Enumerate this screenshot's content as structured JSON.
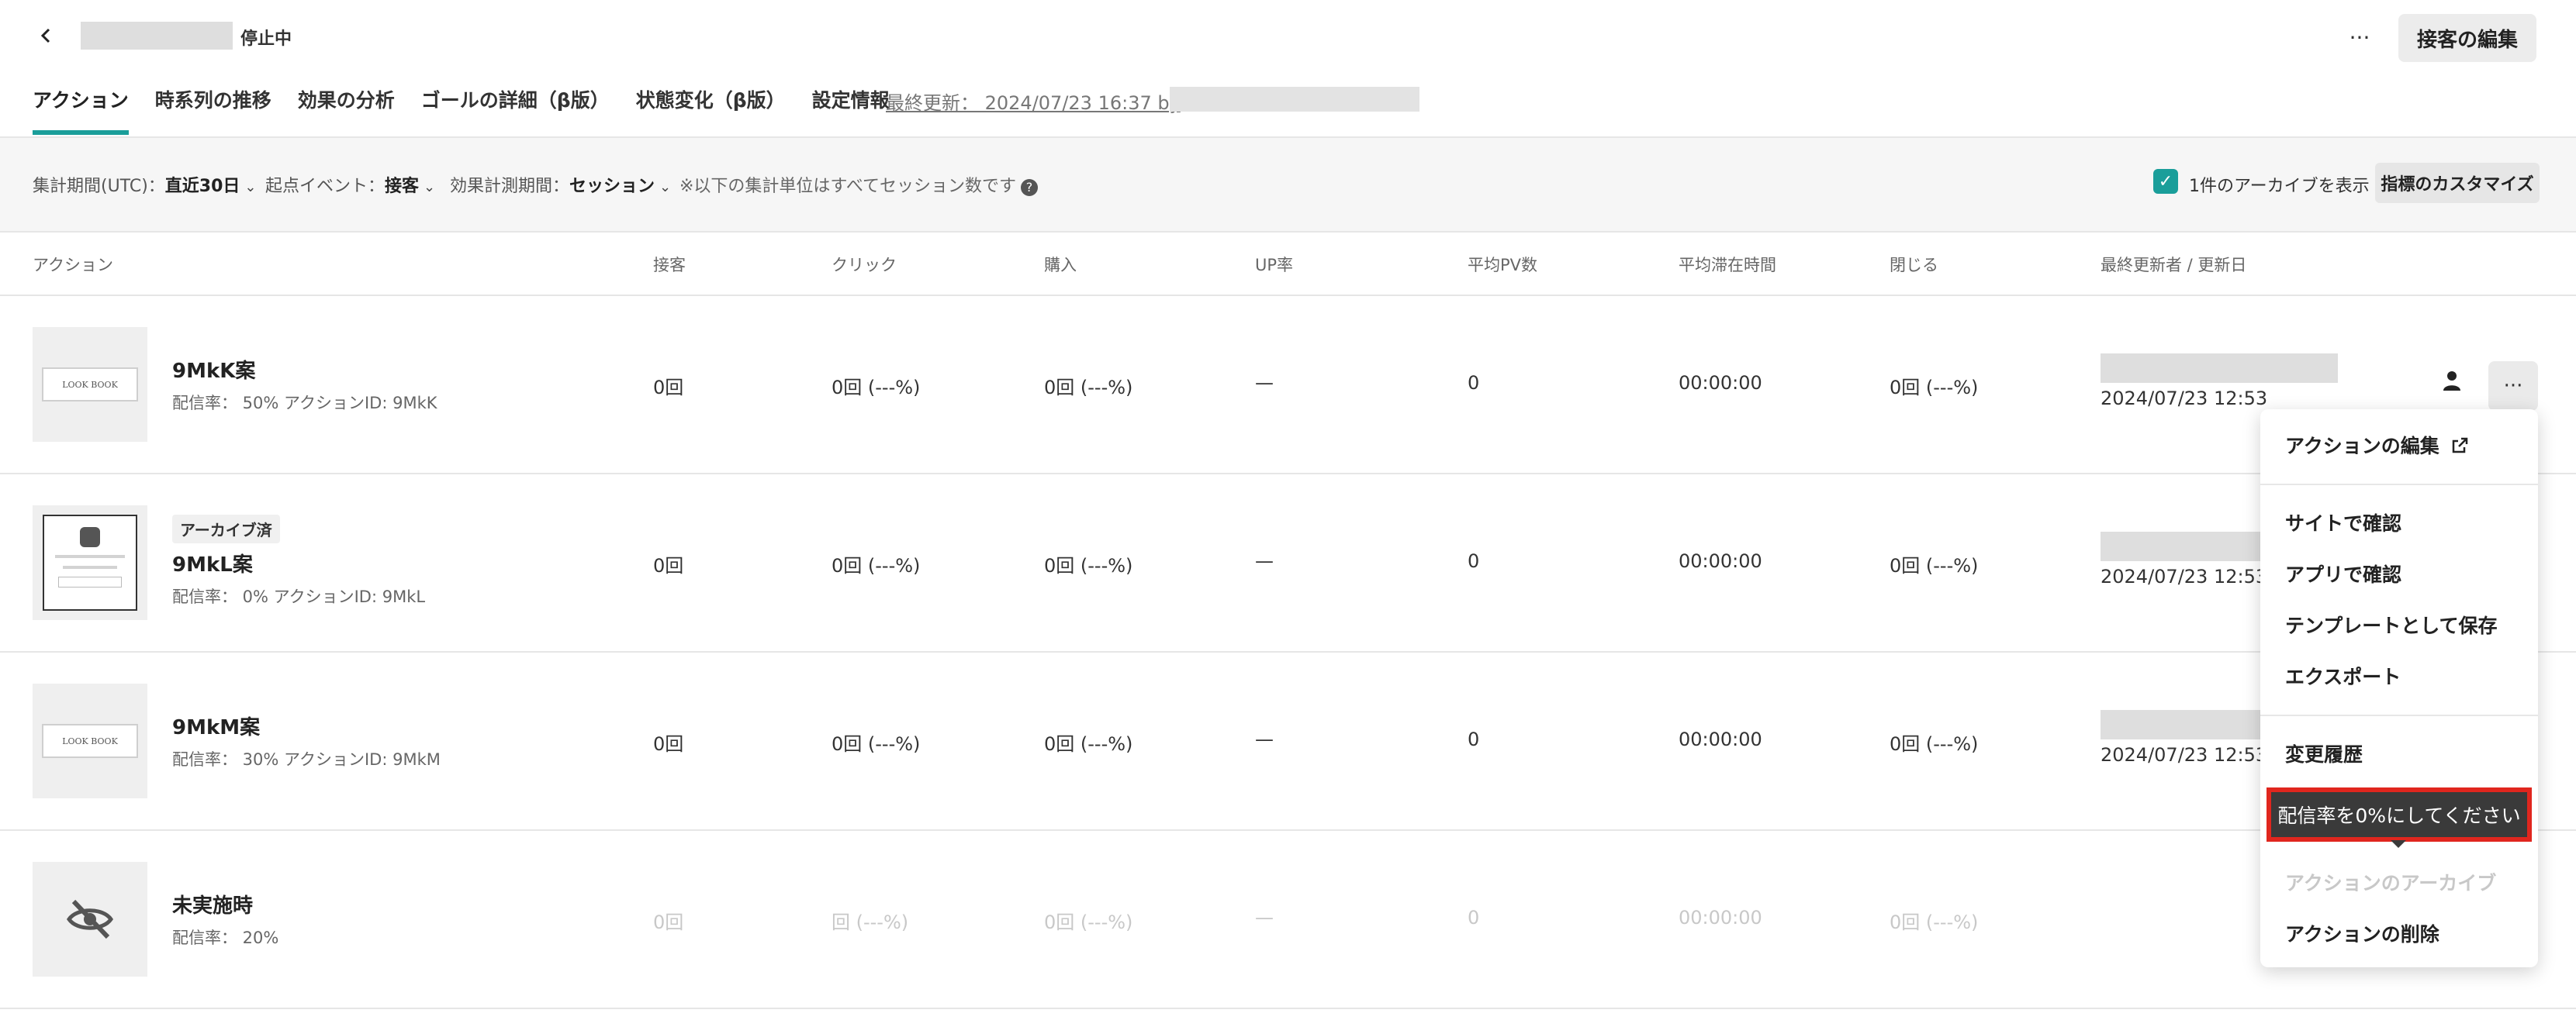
{
  "header": {
    "status": "停止中",
    "more_label": "···",
    "edit_button": "接客の編集",
    "tabs": [
      "アクション",
      "時系列の推移",
      "効果の分析",
      "ゴールの詳細（β版）",
      "状態変化（β版）",
      "設定情報"
    ],
    "updated": "最終更新： 2024/07/23 16:37 by"
  },
  "filters": {
    "period_label": "集計期間(UTC)：",
    "period_value": "直近30日",
    "event_label": "起点イベント：",
    "event_value": "接客",
    "measure_label": "効果計測期間：",
    "measure_value": "セッション",
    "note": "※以下の集計単位はすべてセッション数です",
    "archive_label": "1件のアーカイブを表示",
    "customize_button": "指標のカスタマイズ"
  },
  "table": {
    "columns": [
      "アクション",
      "接客",
      "クリック",
      "購入",
      "UP率",
      "平均PV数",
      "平均滞在時間",
      "閉じる",
      "最終更新者 / 更新日"
    ],
    "rows": [
      {
        "name": "9MkK案",
        "meta": "配信率： 50% アクションID: 9MkK",
        "archived": "",
        "serve": "0回",
        "click": "0回 (---%)",
        "purchase": "0回 (---%)",
        "up": "—",
        "pv": "0",
        "stay": "00:00:00",
        "close": "0回 (---%)",
        "date": "2024/07/23 12:53"
      },
      {
        "name": "9MkL案",
        "meta": "配信率： 0% アクションID: 9MkL",
        "archived": "アーカイブ済",
        "serve": "0回",
        "click": "0回 (---%)",
        "purchase": "0回 (---%)",
        "up": "—",
        "pv": "0",
        "stay": "00:00:00",
        "close": "0回 (---%)",
        "date": "2024/07/23 12:53"
      },
      {
        "name": "9MkM案",
        "meta": "配信率： 30% アクションID: 9MkM",
        "archived": "",
        "serve": "0回",
        "click": "0回 (---%)",
        "purchase": "0回 (---%)",
        "up": "—",
        "pv": "0",
        "stay": "00:00:00",
        "close": "0回 (---%)",
        "date": "2024/07/23 12:53"
      },
      {
        "name": "未実施時",
        "meta": "配信率： 20%",
        "archived": "",
        "serve": "0回",
        "click": "回 (---%)",
        "purchase": "0回 (---%)",
        "up": "—",
        "pv": "0",
        "stay": "00:00:00",
        "close": "0回 (---%)",
        "date": ""
      }
    ]
  },
  "thumbs": {
    "lookbook": "LOOK BOOK"
  },
  "menu": {
    "items": [
      "アクションの編集",
      "サイトで確認",
      "アプリで確認",
      "テンプレートとして保存",
      "エクスポート",
      "変更履歴",
      "アクションのアーカイブ",
      "アクションの削除"
    ],
    "tooltip": "配信率を0%にしてください"
  },
  "colors": {
    "accent": "#1a9e9a",
    "highlight": "#e0261e"
  }
}
